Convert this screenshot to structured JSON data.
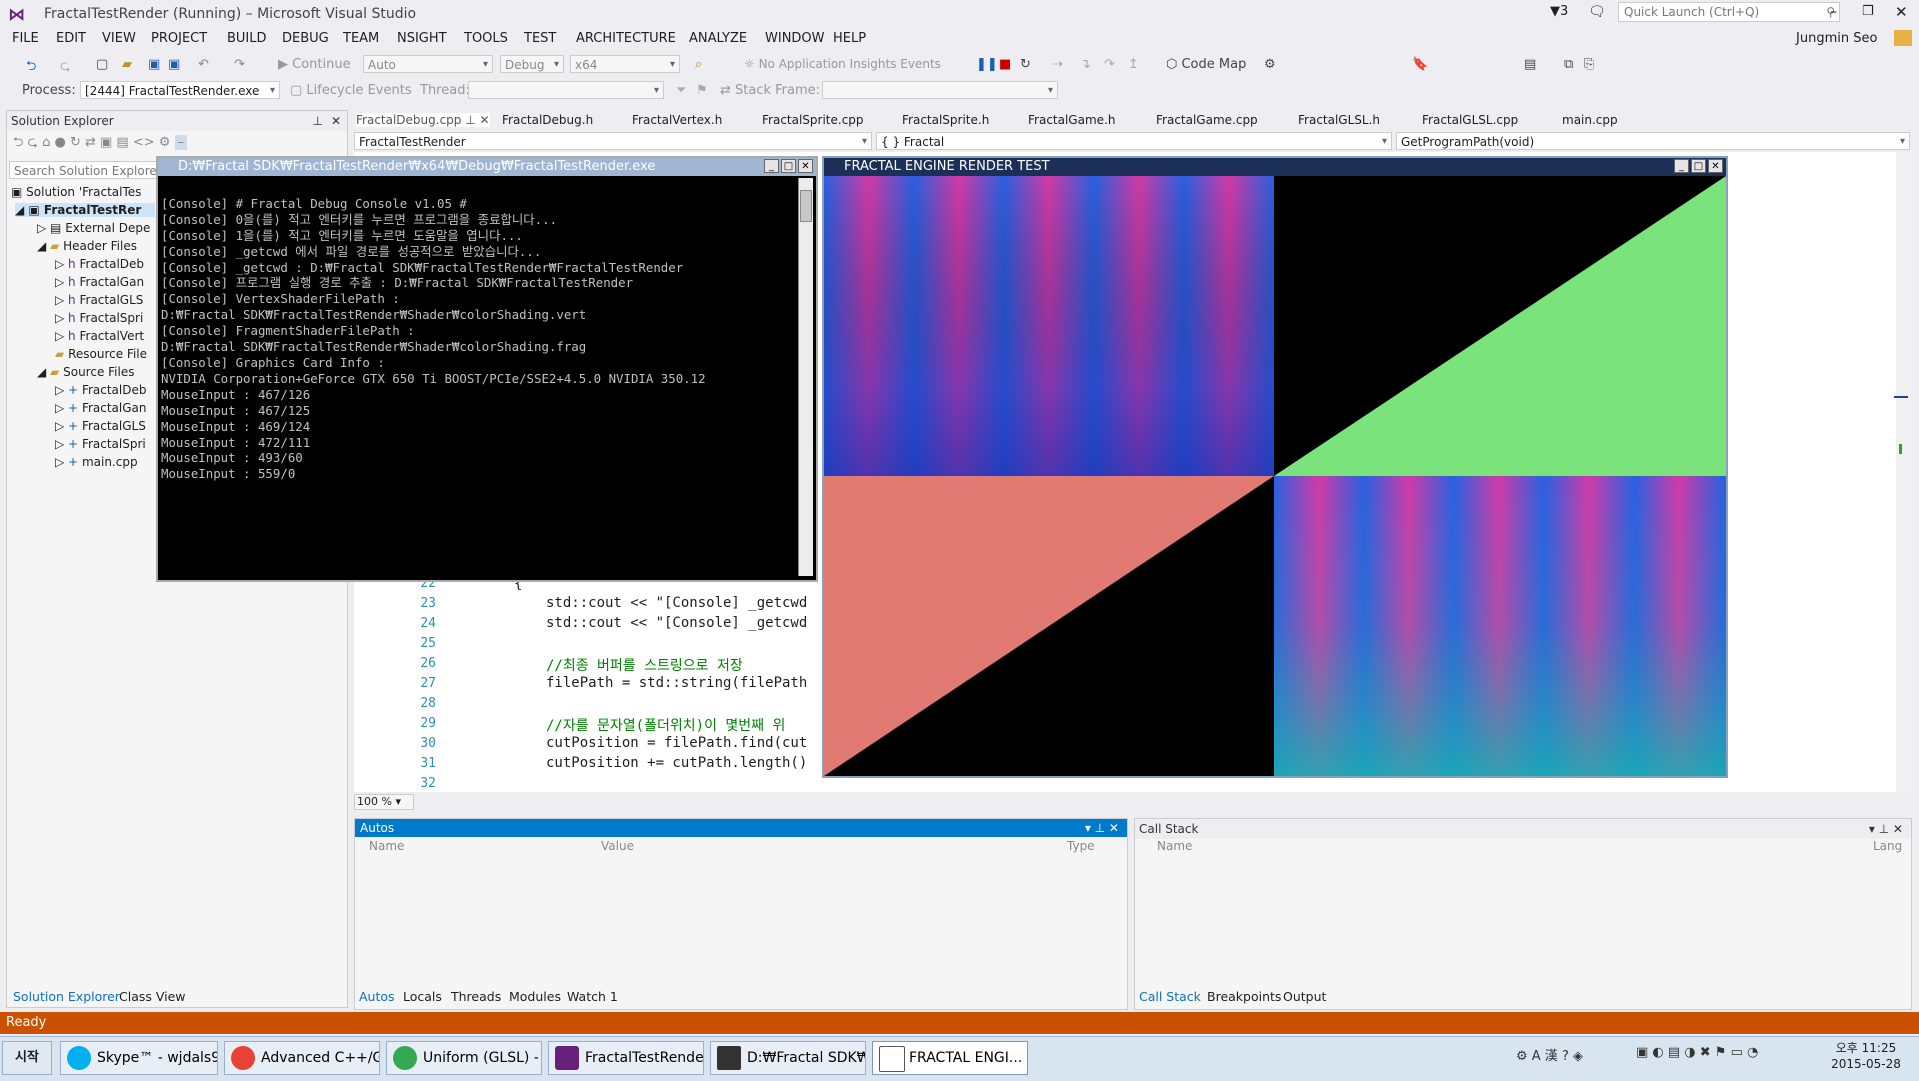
{
  "app": {
    "title": "FractalTestRender (Running) – Microsoft Visual Studio",
    "notification_count": "3",
    "quick_launch_placeholder": "Quick Launch (Ctrl+Q)",
    "user": "Jungmin Seo"
  },
  "menu": [
    "FILE",
    "EDIT",
    "VIEW",
    "PROJECT",
    "BUILD",
    "DEBUG",
    "TEAM",
    "NSIGHT",
    "TOOLS",
    "TEST",
    "ARCHITECTURE",
    "ANALYZE",
    "WINDOW",
    "HELP"
  ],
  "toolbar": {
    "continue_label": "Continue",
    "config_auto": "Auto",
    "config_debug": "Debug",
    "platform": "x64",
    "insights": "No Application Insights Events",
    "code_map": "Code Map"
  },
  "toolbar2": {
    "process_label": "Process:",
    "process_value": "[2444] FractalTestRender.exe",
    "lifecycle": "Lifecycle Events",
    "thread_label": "Thread:",
    "stack_frame_label": "Stack Frame:"
  },
  "solution_explorer": {
    "title": "Solution Explorer",
    "search_placeholder": "Search Solution Explorer",
    "items": [
      {
        "label": "Solution 'FractalTes"
      },
      {
        "label": "FractalTestRer"
      },
      {
        "label": "External Depe"
      },
      {
        "label": "Header Files"
      },
      {
        "label": "FractalDeb"
      },
      {
        "label": "FractalGan"
      },
      {
        "label": "FractalGLS"
      },
      {
        "label": "FractalSpri"
      },
      {
        "label": "FractalVert"
      },
      {
        "label": "Resource File"
      },
      {
        "label": "Source Files"
      },
      {
        "label": "FractalDeb"
      },
      {
        "label": "FractalGan"
      },
      {
        "label": "FractalGLS"
      },
      {
        "label": "FractalSpri"
      },
      {
        "label": "main.cpp"
      }
    ],
    "tabs": [
      "Solution Explorer",
      "Class View"
    ]
  },
  "doc_tabs": [
    "FractalDebug.cpp",
    "FractalDebug.h",
    "FractalVertex.h",
    "FractalSprite.cpp",
    "FractalSprite.h",
    "FractalGame.h",
    "FractalGame.cpp",
    "FractalGLSL.h",
    "FractalGLSL.cpp",
    "main.cpp"
  ],
  "nav": {
    "project": "FractalTestRender",
    "scope": "{ } Fractal",
    "member": "GetProgramPath(void)"
  },
  "editor": {
    "zoom": "100 %",
    "lines": [
      {
        "num": "22",
        "code": "{"
      },
      {
        "num": "23",
        "code": "std::cout << \"[Console] _getcwd"
      },
      {
        "num": "24",
        "code": "std::cout << \"[Console] _getcwd"
      },
      {
        "num": "25",
        "code": ""
      },
      {
        "num": "26",
        "code": "//최종 버퍼를 스트링으로 저장"
      },
      {
        "num": "27",
        "code": "filePath = std::string(filePath"
      },
      {
        "num": "28",
        "code": ""
      },
      {
        "num": "29",
        "code": "//자를 문자열(폴더위치)이 몇번째 위"
      },
      {
        "num": "30",
        "code": "cutPosition = filePath.find(cut"
      },
      {
        "num": "31",
        "code": "cutPosition += cutPath.length()"
      },
      {
        "num": "32",
        "code": ""
      }
    ]
  },
  "console": {
    "title": "D:₩Fractal SDK₩FractalTestRender₩x64₩Debug₩FractalTestRender.exe",
    "lines": [
      "[Console] # Fractal Debug Console v1.05 #",
      "[Console] 0을(를) 적고 엔터키를 누르면 프로그램을 종료합니다...",
      "[Console] 1을(를) 적고 엔터키를 누르면 도움말을 엽니다...",
      "[Console] _getcwd 에서 파일 경로를 성공적으로 받았습니다...",
      "[Console] _getcwd : D:₩Fractal SDK₩FractalTestRender₩FractalTestRender",
      "[Console] 프로그램 실행 경로 추출 : D:₩Fractal SDK₩FractalTestRender",
      "[Console] VertexShaderFilePath :",
      "D:₩Fractal SDK₩FractalTestRender₩Shader₩colorShading.vert",
      "[Console] FragmentShaderFilePath :",
      "D:₩Fractal SDK₩FractalTestRender₩Shader₩colorShading.frag",
      "[Console] Graphics Card Info :",
      "NVIDIA Corporation+GeForce GTX 650 Ti BOOST/PCIe/SSE2+4.5.0 NVIDIA 350.12",
      "MouseInput : 467/126",
      "MouseInput : 467/125",
      "MouseInput : 469/124",
      "MouseInput : 472/111",
      "MouseInput : 493/60",
      "MouseInput : 559/0"
    ]
  },
  "render_window": {
    "title": "FRACTAL ENGINE RENDER TEST",
    "colors": {
      "green": "#7be37b",
      "salmon": "#e07a72"
    }
  },
  "autos": {
    "title": "Autos",
    "columns": [
      "Name",
      "Value",
      "Type"
    ],
    "tabs": [
      "Autos",
      "Locals",
      "Threads",
      "Modules",
      "Watch 1"
    ]
  },
  "callstack": {
    "title": "Call Stack",
    "columns": [
      "Name",
      "Lang"
    ],
    "tabs": [
      "Call Stack",
      "Breakpoints",
      "Output"
    ]
  },
  "status": "Ready",
  "taskbar": {
    "start": "시작",
    "items": [
      "Skype™ - wjdals9...",
      "Advanced C++/Gr...",
      "Uniform (GLSL) - ...",
      "FractalTestRender...",
      "D:₩Fractal SDK₩...",
      "FRACTAL ENGI..."
    ],
    "time": "오후 11:25",
    "date": "2015-05-28"
  },
  "colors": {
    "accent": "#007acc",
    "status": "#ca5100"
  }
}
